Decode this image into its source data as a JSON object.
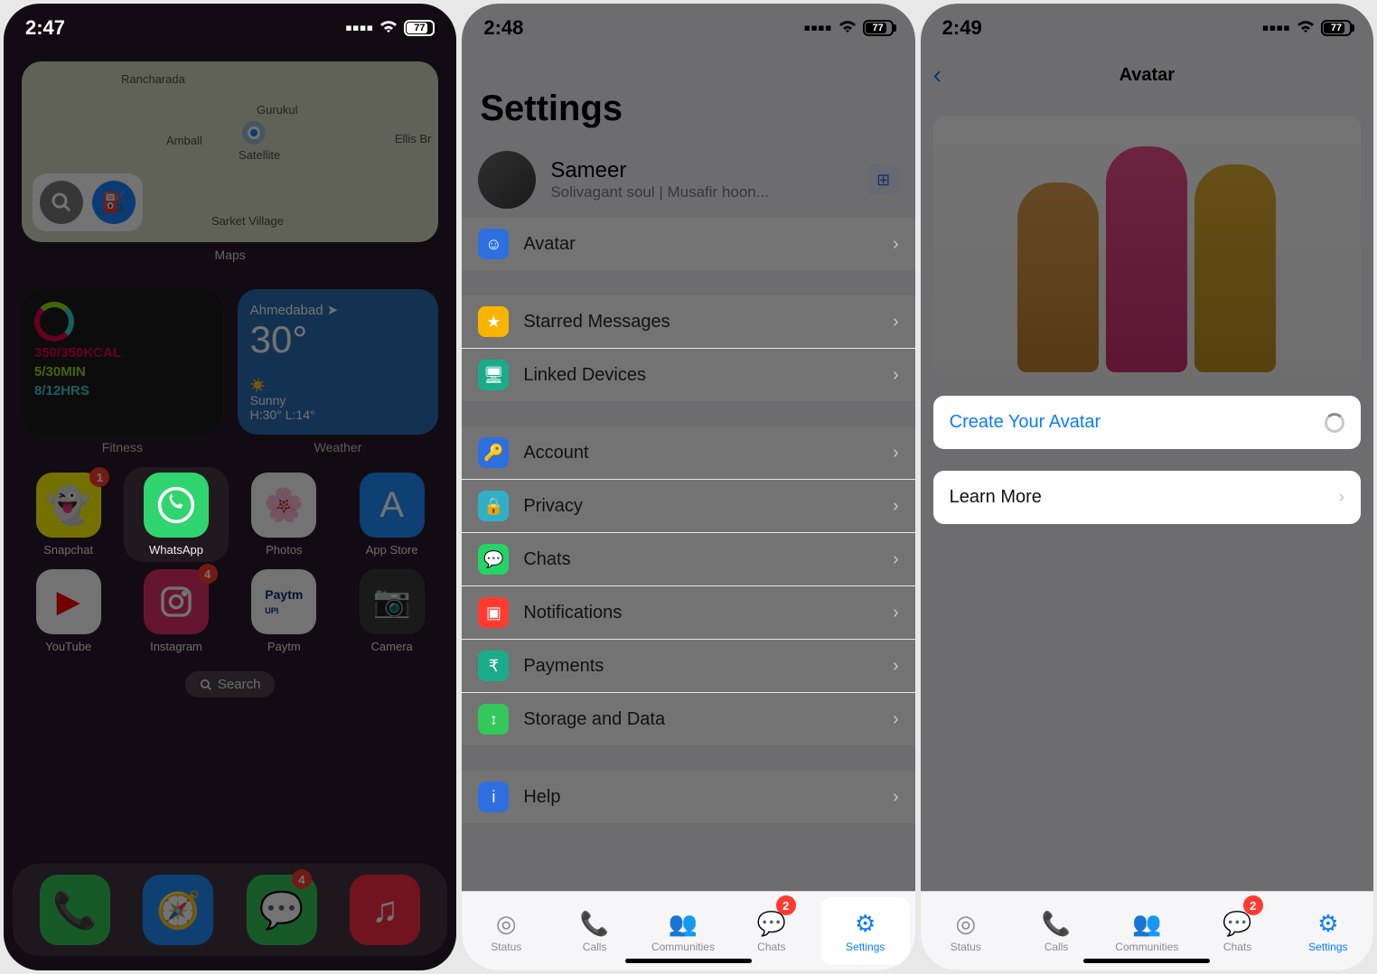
{
  "status": {
    "time1": "2:47",
    "time2": "2:48",
    "time3": "2:49",
    "battery": "77"
  },
  "phone1": {
    "map_label": "Maps",
    "map_places": [
      "Rancharada",
      "Gurukul",
      "Amball",
      "Satellite",
      "Ellis Br",
      "Sarket Village"
    ],
    "fitness": {
      "label": "Fitness",
      "line1": "350/350KCAL",
      "line2": "5/30MIN",
      "line3": "8/12HRS"
    },
    "weather": {
      "label": "Weather",
      "city": "Ahmedabad",
      "temp": "30°",
      "cond": "Sunny",
      "range": "H:30° L:14°"
    },
    "apps": [
      {
        "name": "Snapchat",
        "color": "#fffc00",
        "badge": "1"
      },
      {
        "name": "WhatsApp",
        "color": "#25d366",
        "hl": true
      },
      {
        "name": "Photos",
        "color": "#ffffff"
      },
      {
        "name": "App Store",
        "color": "#1f8fff"
      }
    ],
    "apps2": [
      {
        "name": "YouTube",
        "color": "#ffffff"
      },
      {
        "name": "Instagram",
        "color": "#e1306c",
        "badge": "4"
      },
      {
        "name": "Paytm",
        "color": "#ffffff"
      },
      {
        "name": "Camera",
        "color": "#3a3a3a"
      }
    ],
    "search": "Search",
    "dock": [
      {
        "name": "Phone",
        "color": "#34c759"
      },
      {
        "name": "Safari",
        "color": "#1f8fff"
      },
      {
        "name": "Messages",
        "color": "#34c759",
        "badge": "4"
      },
      {
        "name": "Music",
        "color": "#fa2d48"
      }
    ]
  },
  "phone2": {
    "title": "Settings",
    "profile": {
      "name": "Sameer",
      "sub": "Solivagant soul | Musafir hoon..."
    },
    "rows": [
      {
        "label": "Avatar",
        "color": "#2e6fe0",
        "icon": "☺",
        "hl": true
      },
      {
        "label": "Starred Messages",
        "color": "#f7b500",
        "icon": "★"
      },
      {
        "label": "Linked Devices",
        "color": "#1aab8a",
        "icon": "🖥"
      },
      {
        "label": "Account",
        "color": "#2e6fe0",
        "icon": "🔑"
      },
      {
        "label": "Privacy",
        "color": "#30b0c7",
        "icon": "🔒"
      },
      {
        "label": "Chats",
        "color": "#25d366",
        "icon": "💬"
      },
      {
        "label": "Notifications",
        "color": "#ff3b30",
        "icon": "▣"
      },
      {
        "label": "Payments",
        "color": "#1aab8a",
        "icon": "₹"
      },
      {
        "label": "Storage and Data",
        "color": "#34c759",
        "icon": "↕"
      },
      {
        "label": "Help",
        "color": "#2e6fe0",
        "icon": "i"
      }
    ],
    "tabs": [
      "Status",
      "Calls",
      "Communities",
      "Chats",
      "Settings"
    ],
    "chats_badge": "2"
  },
  "phone3": {
    "title": "Avatar",
    "create": "Create Your Avatar",
    "learn": "Learn More",
    "tabs": [
      "Status",
      "Calls",
      "Communities",
      "Chats",
      "Settings"
    ],
    "chats_badge": "2"
  }
}
